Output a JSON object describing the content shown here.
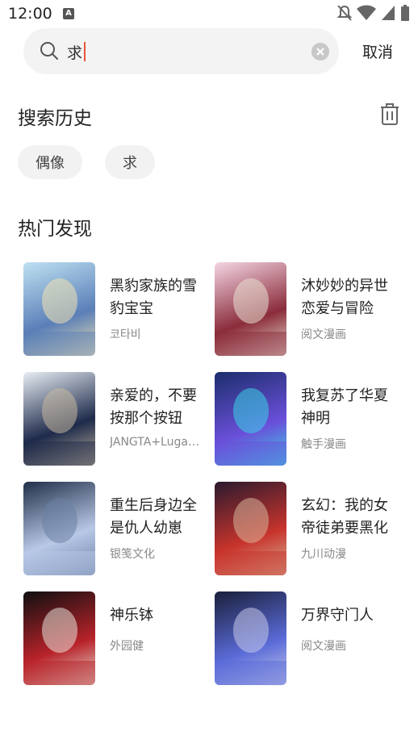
{
  "status_bar": {
    "time": "12:00",
    "app_icon_letter": "A"
  },
  "search": {
    "query": "求",
    "cancel_label": "取消"
  },
  "history": {
    "title": "搜索历史",
    "tags": [
      "偶像",
      "求"
    ]
  },
  "hot": {
    "title": "热门发现",
    "items": [
      {
        "title": "黑豹家族的雪豹宝宝",
        "author": "코타비",
        "cover_colors": [
          "#bfe1f2",
          "#5a7fb8",
          "#f3e3b2"
        ]
      },
      {
        "title": "沐妙妙的异世恋爱与冒险",
        "author": "阅文漫画",
        "cover_colors": [
          "#f4d6e4",
          "#8b2c3b",
          "#e9e2d4"
        ]
      },
      {
        "title": "亲爱的，不要按那个按钮",
        "author": "JANGTA+Luga+…",
        "cover_colors": [
          "#e8eef4",
          "#1d2a4a",
          "#c7b8a0"
        ]
      },
      {
        "title": "我复苏了华夏神明",
        "author": "触手漫画",
        "cover_colors": [
          "#1b2e6b",
          "#6a4fd9",
          "#3bd3e6"
        ]
      },
      {
        "title": "重生后身边全是仇人幼崽",
        "author": "银笺文化",
        "cover_colors": [
          "#20304a",
          "#b8c8e6",
          "#6b7fa5"
        ]
      },
      {
        "title": "玄幻：我的女帝徒弟要黑化",
        "author": "九川动漫",
        "cover_colors": [
          "#2a1a2e",
          "#c8342c",
          "#d8b59a"
        ]
      },
      {
        "title": "神乐钵",
        "author": "外园健",
        "cover_colors": [
          "#0f0f10",
          "#b8232a",
          "#e7e2d8"
        ]
      },
      {
        "title": "万界守门人",
        "author": "阅文漫画",
        "cover_colors": [
          "#1a1f3a",
          "#5a6bd8",
          "#c7c9ea"
        ]
      }
    ]
  }
}
